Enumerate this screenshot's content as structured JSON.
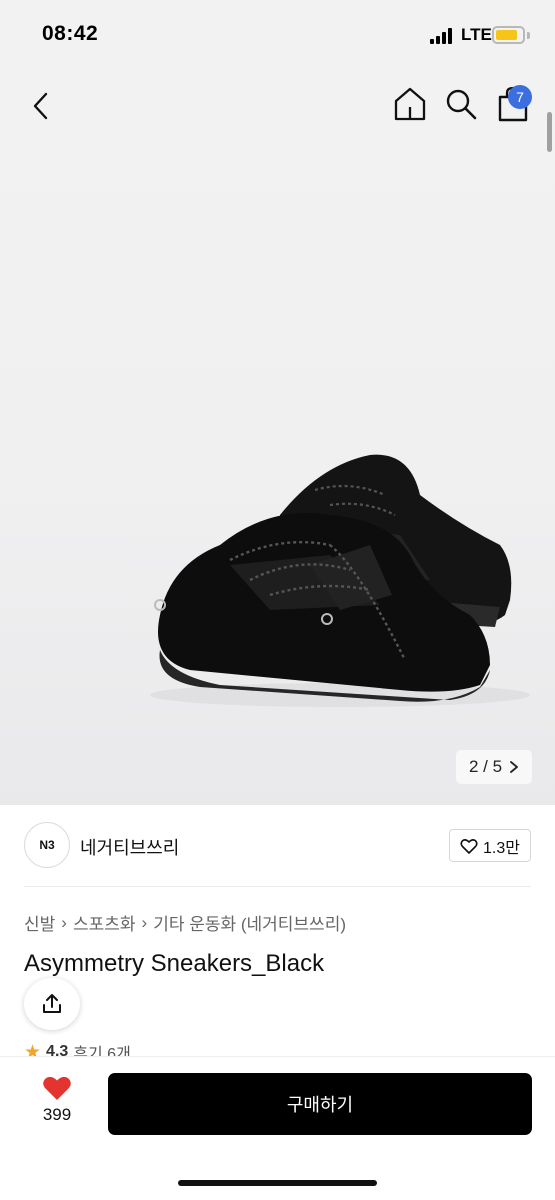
{
  "status_bar": {
    "time": "08:42",
    "network": "LTE"
  },
  "nav": {
    "back_icon": "chevron-left-icon",
    "home_icon": "home-icon",
    "search_icon": "search-icon",
    "cart_icon": "shopping-bag-icon",
    "cart_count": "7",
    "badge_color": "#3b6fe0"
  },
  "gallery": {
    "counter": "2 / 5",
    "next_icon": "chevron-right-icon"
  },
  "brand": {
    "logo_text": "N3",
    "name": "네거티브쓰리",
    "likes": "1.3만"
  },
  "breadcrumb": [
    "신발",
    "스포츠화",
    "기타 운동화 (네거티브쓰리)"
  ],
  "product": {
    "title": "Asymmetry Sneakers_Black"
  },
  "rating": {
    "score": "4.3",
    "reviews": "후기 6개",
    "star_color": "#f0a52b"
  },
  "bottom": {
    "wish_count": "399",
    "buy_label": "구매하기",
    "heart_color": "#e3342f"
  }
}
